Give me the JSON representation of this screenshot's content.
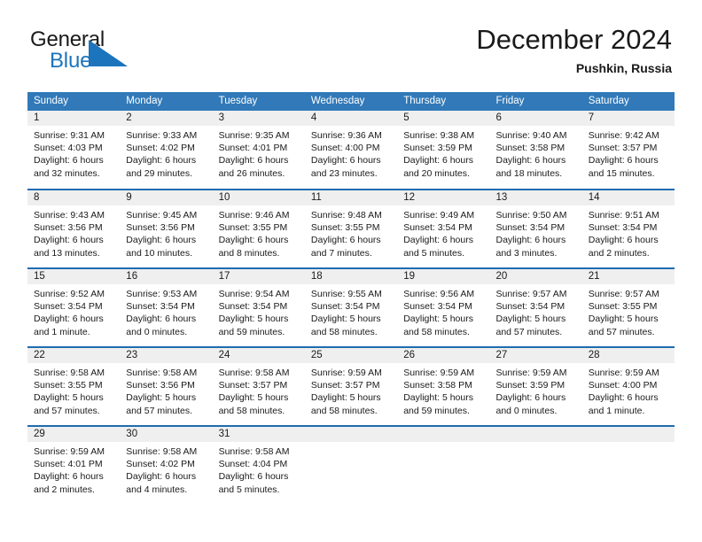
{
  "logo": {
    "word_one": "General",
    "word_two": "Blue",
    "triangle_color": "#1C74BC",
    "text_color": "#1a1a1a"
  },
  "header": {
    "title": "December 2024",
    "location": "Pushkin, Russia"
  },
  "theme": {
    "header_blue": "#3179B8",
    "row_divider_blue": "#1F6CB0",
    "daynum_band": "#EFEFEF",
    "text": "#1a1a1a",
    "page_background": "#ffffff"
  },
  "weekday_headers": [
    "Sunday",
    "Monday",
    "Tuesday",
    "Wednesday",
    "Thursday",
    "Friday",
    "Saturday"
  ],
  "weeks": [
    [
      {
        "day": "1",
        "sunrise": "Sunrise: 9:31 AM",
        "sunset": "Sunset: 4:03 PM",
        "daylight_line1": "Daylight: 6 hours",
        "daylight_line2": "and 32 minutes."
      },
      {
        "day": "2",
        "sunrise": "Sunrise: 9:33 AM",
        "sunset": "Sunset: 4:02 PM",
        "daylight_line1": "Daylight: 6 hours",
        "daylight_line2": "and 29 minutes."
      },
      {
        "day": "3",
        "sunrise": "Sunrise: 9:35 AM",
        "sunset": "Sunset: 4:01 PM",
        "daylight_line1": "Daylight: 6 hours",
        "daylight_line2": "and 26 minutes."
      },
      {
        "day": "4",
        "sunrise": "Sunrise: 9:36 AM",
        "sunset": "Sunset: 4:00 PM",
        "daylight_line1": "Daylight: 6 hours",
        "daylight_line2": "and 23 minutes."
      },
      {
        "day": "5",
        "sunrise": "Sunrise: 9:38 AM",
        "sunset": "Sunset: 3:59 PM",
        "daylight_line1": "Daylight: 6 hours",
        "daylight_line2": "and 20 minutes."
      },
      {
        "day": "6",
        "sunrise": "Sunrise: 9:40 AM",
        "sunset": "Sunset: 3:58 PM",
        "daylight_line1": "Daylight: 6 hours",
        "daylight_line2": "and 18 minutes."
      },
      {
        "day": "7",
        "sunrise": "Sunrise: 9:42 AM",
        "sunset": "Sunset: 3:57 PM",
        "daylight_line1": "Daylight: 6 hours",
        "daylight_line2": "and 15 minutes."
      }
    ],
    [
      {
        "day": "8",
        "sunrise": "Sunrise: 9:43 AM",
        "sunset": "Sunset: 3:56 PM",
        "daylight_line1": "Daylight: 6 hours",
        "daylight_line2": "and 13 minutes."
      },
      {
        "day": "9",
        "sunrise": "Sunrise: 9:45 AM",
        "sunset": "Sunset: 3:56 PM",
        "daylight_line1": "Daylight: 6 hours",
        "daylight_line2": "and 10 minutes."
      },
      {
        "day": "10",
        "sunrise": "Sunrise: 9:46 AM",
        "sunset": "Sunset: 3:55 PM",
        "daylight_line1": "Daylight: 6 hours",
        "daylight_line2": "and 8 minutes."
      },
      {
        "day": "11",
        "sunrise": "Sunrise: 9:48 AM",
        "sunset": "Sunset: 3:55 PM",
        "daylight_line1": "Daylight: 6 hours",
        "daylight_line2": "and 7 minutes."
      },
      {
        "day": "12",
        "sunrise": "Sunrise: 9:49 AM",
        "sunset": "Sunset: 3:54 PM",
        "daylight_line1": "Daylight: 6 hours",
        "daylight_line2": "and 5 minutes."
      },
      {
        "day": "13",
        "sunrise": "Sunrise: 9:50 AM",
        "sunset": "Sunset: 3:54 PM",
        "daylight_line1": "Daylight: 6 hours",
        "daylight_line2": "and 3 minutes."
      },
      {
        "day": "14",
        "sunrise": "Sunrise: 9:51 AM",
        "sunset": "Sunset: 3:54 PM",
        "daylight_line1": "Daylight: 6 hours",
        "daylight_line2": "and 2 minutes."
      }
    ],
    [
      {
        "day": "15",
        "sunrise": "Sunrise: 9:52 AM",
        "sunset": "Sunset: 3:54 PM",
        "daylight_line1": "Daylight: 6 hours",
        "daylight_line2": "and 1 minute."
      },
      {
        "day": "16",
        "sunrise": "Sunrise: 9:53 AM",
        "sunset": "Sunset: 3:54 PM",
        "daylight_line1": "Daylight: 6 hours",
        "daylight_line2": "and 0 minutes."
      },
      {
        "day": "17",
        "sunrise": "Sunrise: 9:54 AM",
        "sunset": "Sunset: 3:54 PM",
        "daylight_line1": "Daylight: 5 hours",
        "daylight_line2": "and 59 minutes."
      },
      {
        "day": "18",
        "sunrise": "Sunrise: 9:55 AM",
        "sunset": "Sunset: 3:54 PM",
        "daylight_line1": "Daylight: 5 hours",
        "daylight_line2": "and 58 minutes."
      },
      {
        "day": "19",
        "sunrise": "Sunrise: 9:56 AM",
        "sunset": "Sunset: 3:54 PM",
        "daylight_line1": "Daylight: 5 hours",
        "daylight_line2": "and 58 minutes."
      },
      {
        "day": "20",
        "sunrise": "Sunrise: 9:57 AM",
        "sunset": "Sunset: 3:54 PM",
        "daylight_line1": "Daylight: 5 hours",
        "daylight_line2": "and 57 minutes."
      },
      {
        "day": "21",
        "sunrise": "Sunrise: 9:57 AM",
        "sunset": "Sunset: 3:55 PM",
        "daylight_line1": "Daylight: 5 hours",
        "daylight_line2": "and 57 minutes."
      }
    ],
    [
      {
        "day": "22",
        "sunrise": "Sunrise: 9:58 AM",
        "sunset": "Sunset: 3:55 PM",
        "daylight_line1": "Daylight: 5 hours",
        "daylight_line2": "and 57 minutes."
      },
      {
        "day": "23",
        "sunrise": "Sunrise: 9:58 AM",
        "sunset": "Sunset: 3:56 PM",
        "daylight_line1": "Daylight: 5 hours",
        "daylight_line2": "and 57 minutes."
      },
      {
        "day": "24",
        "sunrise": "Sunrise: 9:58 AM",
        "sunset": "Sunset: 3:57 PM",
        "daylight_line1": "Daylight: 5 hours",
        "daylight_line2": "and 58 minutes."
      },
      {
        "day": "25",
        "sunrise": "Sunrise: 9:59 AM",
        "sunset": "Sunset: 3:57 PM",
        "daylight_line1": "Daylight: 5 hours",
        "daylight_line2": "and 58 minutes."
      },
      {
        "day": "26",
        "sunrise": "Sunrise: 9:59 AM",
        "sunset": "Sunset: 3:58 PM",
        "daylight_line1": "Daylight: 5 hours",
        "daylight_line2": "and 59 minutes."
      },
      {
        "day": "27",
        "sunrise": "Sunrise: 9:59 AM",
        "sunset": "Sunset: 3:59 PM",
        "daylight_line1": "Daylight: 6 hours",
        "daylight_line2": "and 0 minutes."
      },
      {
        "day": "28",
        "sunrise": "Sunrise: 9:59 AM",
        "sunset": "Sunset: 4:00 PM",
        "daylight_line1": "Daylight: 6 hours",
        "daylight_line2": "and 1 minute."
      }
    ],
    [
      {
        "day": "29",
        "sunrise": "Sunrise: 9:59 AM",
        "sunset": "Sunset: 4:01 PM",
        "daylight_line1": "Daylight: 6 hours",
        "daylight_line2": "and 2 minutes."
      },
      {
        "day": "30",
        "sunrise": "Sunrise: 9:58 AM",
        "sunset": "Sunset: 4:02 PM",
        "daylight_line1": "Daylight: 6 hours",
        "daylight_line2": "and 4 minutes."
      },
      {
        "day": "31",
        "sunrise": "Sunrise: 9:58 AM",
        "sunset": "Sunset: 4:04 PM",
        "daylight_line1": "Daylight: 6 hours",
        "daylight_line2": "and 5 minutes."
      },
      {
        "day": "",
        "sunrise": "",
        "sunset": "",
        "daylight_line1": "",
        "daylight_line2": ""
      },
      {
        "day": "",
        "sunrise": "",
        "sunset": "",
        "daylight_line1": "",
        "daylight_line2": ""
      },
      {
        "day": "",
        "sunrise": "",
        "sunset": "",
        "daylight_line1": "",
        "daylight_line2": ""
      },
      {
        "day": "",
        "sunrise": "",
        "sunset": "",
        "daylight_line1": "",
        "daylight_line2": ""
      }
    ]
  ]
}
